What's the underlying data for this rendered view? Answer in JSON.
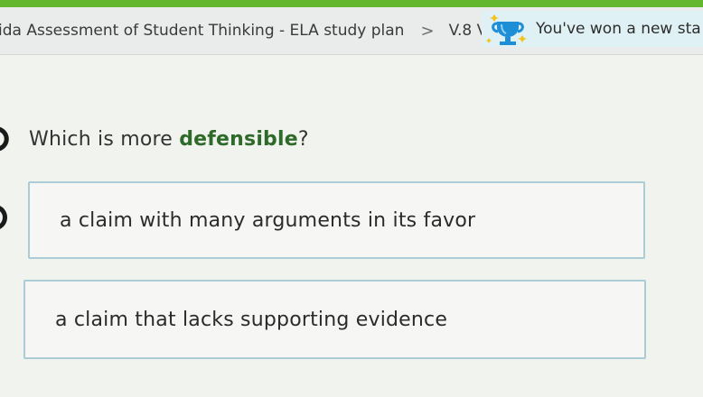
{
  "header": {
    "breadcrumb_title": "ida Assessment of Student Thinking - ELA study plan",
    "separator": ">",
    "skill_code": "V.8 V",
    "award_text": "You've won a new sta"
  },
  "question": {
    "prefix": "Which is more ",
    "emphasis": "defensible",
    "suffix": "?"
  },
  "choices": [
    {
      "label": "a claim with many arguments in its favor"
    },
    {
      "label": "a claim that lacks supporting evidence"
    }
  ],
  "colors": {
    "accent_green": "#62b72e",
    "emphasis_green": "#2e6b2a",
    "choice_border": "#a9ccd6",
    "award_bg": "#dff1f4",
    "trophy_blue": "#1e8fd6"
  },
  "icons": {
    "question_audio": "speaker-icon",
    "choice_audio": "speaker-icon",
    "award": "trophy-icon",
    "separator": "chevron-right-icon"
  }
}
